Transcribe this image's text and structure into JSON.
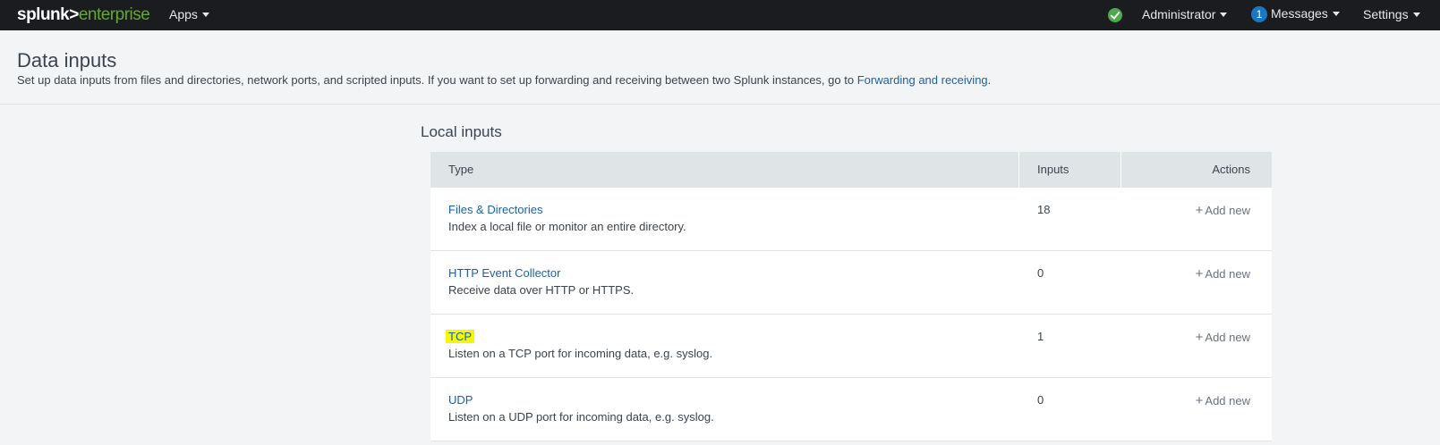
{
  "topbar": {
    "logo_part1": "splunk>",
    "logo_part2": "enterprise",
    "apps_label": "Apps",
    "status_icon": "check-circle-icon",
    "user_label": "Administrator",
    "messages_count": "1",
    "messages_label": "Messages",
    "settings_label": "Settings"
  },
  "header": {
    "title": "Data inputs",
    "description": "Set up data inputs from files and directories, network ports, and scripted inputs. If you want to set up forwarding and receiving between two Splunk instances, go to ",
    "link_text": "Forwarding and receiving",
    "description_end": "."
  },
  "local_inputs": {
    "section_title": "Local inputs",
    "columns": {
      "type": "Type",
      "inputs": "Inputs",
      "actions": "Actions"
    },
    "rows": [
      {
        "name": "Files & Directories",
        "description": "Index a local file or monitor an entire directory.",
        "count": "18",
        "action": "Add new"
      },
      {
        "name": "HTTP Event Collector",
        "description": "Receive data over HTTP or HTTPS.",
        "count": "0",
        "action": "Add new"
      },
      {
        "name": "TCP",
        "description": "Listen on a TCP port for incoming data, e.g. syslog.",
        "count": "1",
        "action": "Add new"
      },
      {
        "name": "UDP",
        "description": "Listen on a UDP port for incoming data, e.g. syslog.",
        "count": "0",
        "action": "Add new"
      }
    ]
  },
  "colors": {
    "topbar_bg": "#1a1c20",
    "logo_accent": "#65a637",
    "link": "#1a62a6",
    "highlight": "#f7f700",
    "badge": "#1a78c2"
  }
}
